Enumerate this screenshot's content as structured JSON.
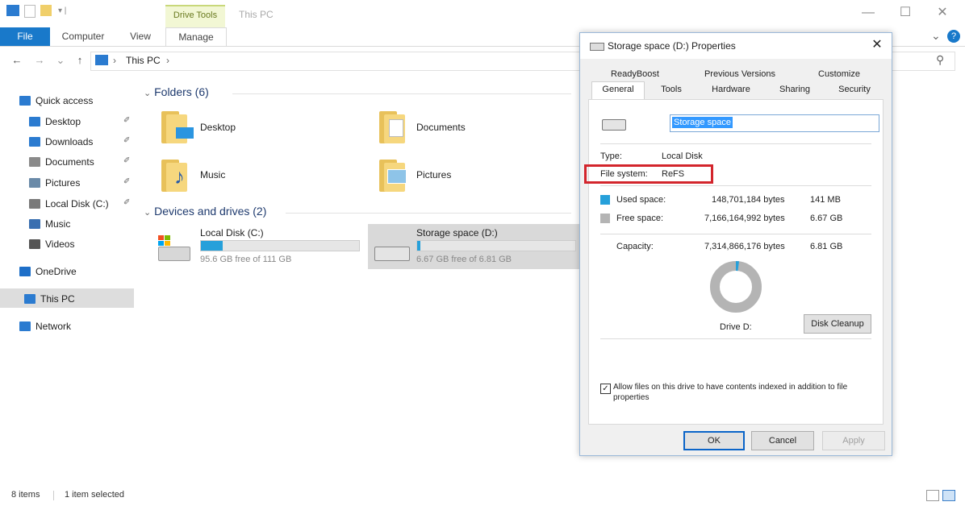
{
  "title_bar": {
    "contextual_tab": "Drive Tools",
    "window_title": "This PC",
    "minimize": "—",
    "maximize": "☐",
    "close": "✕"
  },
  "ribbon": {
    "tabs": [
      "File",
      "Computer",
      "View",
      "Manage"
    ],
    "expand": "⌄",
    "help": "?"
  },
  "address_bar": {
    "back": "←",
    "forward": "→",
    "recent": "⌄",
    "up": "↑",
    "path": "This PC",
    "separator": "›",
    "search_icon": "⚲"
  },
  "nav_pane": {
    "items": [
      {
        "label": "Quick access",
        "color": "#2b7bd0"
      },
      {
        "label": "Desktop",
        "color": "#2b7bd0",
        "pinned": true
      },
      {
        "label": "Downloads",
        "color": "#2b7bd0",
        "pinned": true
      },
      {
        "label": "Documents",
        "color": "#8a8a8a",
        "pinned": true
      },
      {
        "label": "Pictures",
        "color": "#6a8aa8",
        "pinned": true
      },
      {
        "label": "Local Disk (C:)",
        "color": "#7a7a7a",
        "pinned": true
      },
      {
        "label": "Music",
        "color": "#3a6fb0"
      },
      {
        "label": "Videos",
        "color": "#555555"
      },
      {
        "label": "OneDrive",
        "color": "#1e6fc8"
      },
      {
        "label": "This PC",
        "color": "#2b7bd0"
      },
      {
        "label": "Network",
        "color": "#2b7bd0"
      }
    ],
    "pin_glyph": "✐"
  },
  "content": {
    "folders_header": "Folders (6)",
    "folders": [
      {
        "label": "Desktop"
      },
      {
        "label": "Documents"
      },
      {
        "label": "Music"
      },
      {
        "label": "Pictures"
      }
    ],
    "drives_header": "Devices and drives (2)",
    "drives": [
      {
        "label": "Local Disk (C:)",
        "free": "95.6 GB free of 111 GB",
        "used_fraction": 0.14
      },
      {
        "label": "Storage space (D:)",
        "free": "6.67 GB free of 6.81 GB",
        "used_fraction": 0.02
      }
    ]
  },
  "status_bar": {
    "items_count": "8 items",
    "selected": "1 item selected"
  },
  "dialog": {
    "title": "Storage space (D:) Properties",
    "close": "✕",
    "tabs_row1": [
      "ReadyBoost",
      "Previous Versions",
      "Customize"
    ],
    "tabs_row2": [
      "General",
      "Tools",
      "Hardware",
      "Sharing",
      "Security"
    ],
    "name_value": "Storage space",
    "type_label": "Type:",
    "type_value": "Local Disk",
    "fs_label": "File system:",
    "fs_value": "ReFS",
    "used_label": "Used space:",
    "used_bytes": "148,701,184 bytes",
    "used_size": "141 MB",
    "free_label": "Free space:",
    "free_bytes": "7,166,164,992 bytes",
    "free_size": "6.67 GB",
    "capacity_label": "Capacity:",
    "capacity_bytes": "7,314,866,176 bytes",
    "capacity_size": "6.81 GB",
    "used_fraction": 0.02,
    "drive_label": "Drive D:",
    "disk_cleanup": "Disk Cleanup",
    "index_text": "Allow files on this drive to have contents indexed in addition to file properties",
    "index_checked": "✓",
    "ok": "OK",
    "cancel": "Cancel",
    "apply": "Apply",
    "colors": {
      "used": "#26a0da",
      "free": "#b4b4b4",
      "highlight": "#d3252c"
    }
  }
}
